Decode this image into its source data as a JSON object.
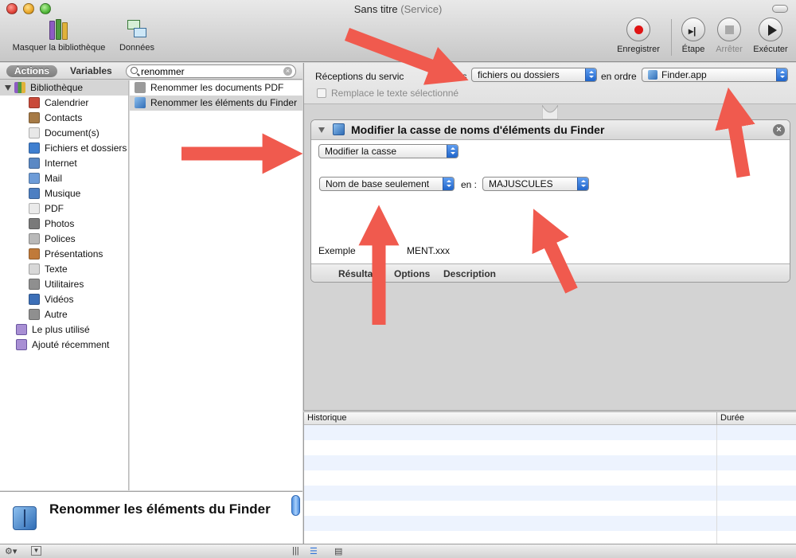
{
  "window": {
    "title": "Sans titre",
    "subtitle": "(Service)"
  },
  "toolbar": {
    "library_label": "Masquer la bibliothèque",
    "data_label": "Données",
    "record_label": "Enregistrer",
    "step_label": "Étape",
    "stop_label": "Arrêter",
    "run_label": "Exécuter"
  },
  "library": {
    "tab_actions": "Actions",
    "tab_variables": "Variables",
    "search_value": "renommer",
    "root_label": "Bibliothèque",
    "categories": [
      {
        "label": "Calendrier",
        "icon": "calendar-icon",
        "color": "#c94a3a"
      },
      {
        "label": "Contacts",
        "icon": "contacts-icon",
        "color": "#a67a45"
      },
      {
        "label": "Document(s)",
        "icon": "document-icon",
        "color": "#e8e8e8"
      },
      {
        "label": "Fichiers et dossiers",
        "icon": "finder-icon",
        "color": "#3f7fd0"
      },
      {
        "label": "Internet",
        "icon": "globe-icon",
        "color": "#5a88c4"
      },
      {
        "label": "Mail",
        "icon": "mail-icon",
        "color": "#6d9cd8"
      },
      {
        "label": "Musique",
        "icon": "music-icon",
        "color": "#4d7fc2"
      },
      {
        "label": "PDF",
        "icon": "pdf-icon",
        "color": "#eaeaea"
      },
      {
        "label": "Photos",
        "icon": "photos-icon",
        "color": "#7a7a7a"
      },
      {
        "label": "Polices",
        "icon": "fonts-icon",
        "color": "#b9b9b9"
      },
      {
        "label": "Présentations",
        "icon": "presentation-icon",
        "color": "#c07a3a"
      },
      {
        "label": "Texte",
        "icon": "text-icon",
        "color": "#d8d8d8"
      },
      {
        "label": "Utilitaires",
        "icon": "utilities-icon",
        "color": "#8f8f8f"
      },
      {
        "label": "Vidéos",
        "icon": "video-icon",
        "color": "#3c6fb7"
      },
      {
        "label": "Autre",
        "icon": "other-icon",
        "color": "#8f8f8f"
      }
    ],
    "smart_groups": [
      {
        "label": "Le plus utilisé",
        "icon": "smart-folder-icon"
      },
      {
        "label": "Ajouté récemment",
        "icon": "smart-folder-icon"
      }
    ],
    "actions": [
      {
        "label": "Renommer les documents PDF",
        "icon": "automator-icon"
      },
      {
        "label": "Renommer les éléments du Finder",
        "icon": "finder-icon"
      }
    ]
  },
  "description": {
    "title": "Renommer les éléments du Finder"
  },
  "service": {
    "receives_label": "Réceptions du servic",
    "receives_suffix": "ces",
    "input_type": "fichiers ou dossiers",
    "in_label": "en ordre",
    "application": "Finder.app",
    "replace_label": "Remplace le texte sélectionné"
  },
  "action": {
    "title": "Modifier la casse de noms d'éléments du Finder",
    "mode_value": "Modifier la casse",
    "scope_value": "Nom de base seulement",
    "en_label": "en :",
    "case_value": "MAJUSCULES",
    "example_prefix": "Exemple",
    "example_suffix": "MENT.xxx",
    "tab_results": "Résulta",
    "tab_options": "Options",
    "tab_description": "Description"
  },
  "log": {
    "col_history": "Historique",
    "col_duration": "Durée"
  },
  "colors": {
    "annotation_arrow": "#f05a4e",
    "popup_accent": "#2f74d8",
    "selection": "#d5d5d5"
  }
}
